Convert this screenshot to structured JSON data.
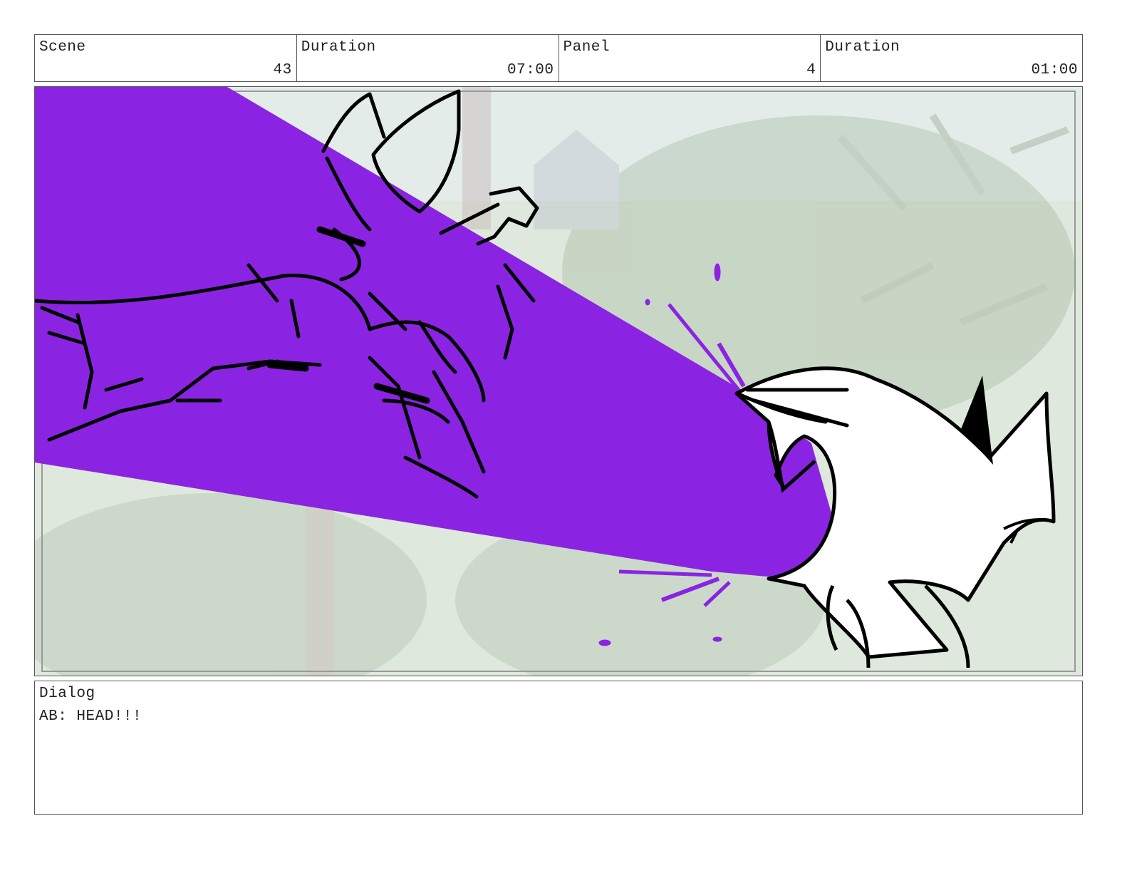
{
  "header": {
    "scene_label": "Scene",
    "scene_value": "43",
    "scene_duration_label": "Duration",
    "scene_duration_value": "07:00",
    "panel_label": "Panel",
    "panel_value": "4",
    "panel_duration_label": "Duration",
    "panel_duration_value": "01:00"
  },
  "panel_image": {
    "beam_color": "#8A24E2",
    "background_tint": "#DCE6DC",
    "ink_color": "#000000"
  },
  "dialog": {
    "label": "Dialog",
    "text": "AB: HEAD!!!"
  }
}
